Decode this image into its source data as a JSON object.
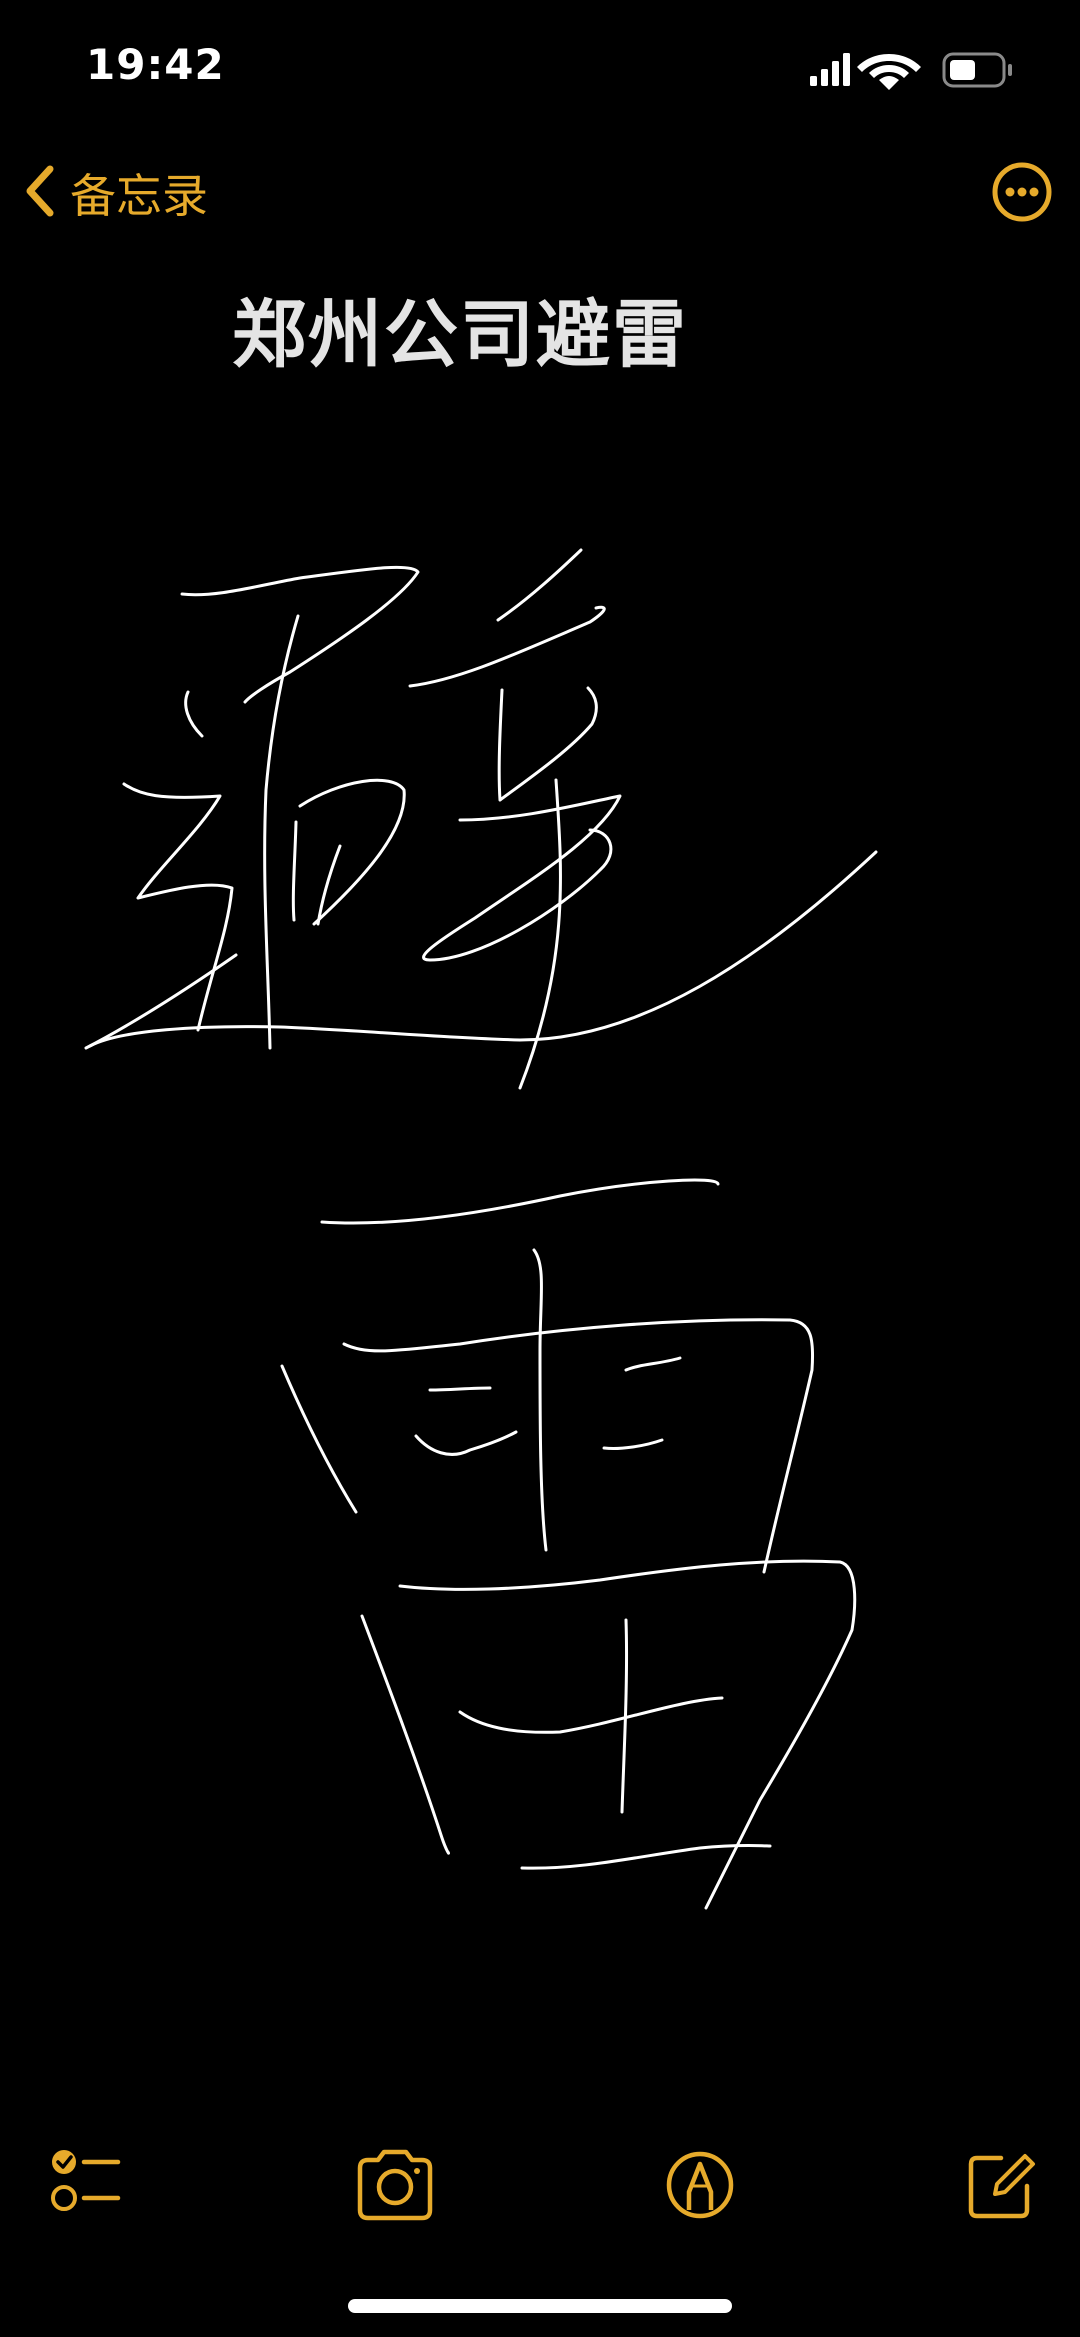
{
  "status_bar": {
    "time": "19:42",
    "icons": [
      "cellular-signal-icon",
      "wifi-icon",
      "battery-icon"
    ],
    "battery_level": 0.45
  },
  "nav": {
    "back_label": "备忘录",
    "back_icon": "chevron-left-icon",
    "more_icon": "more-ellipsis-icon"
  },
  "note": {
    "title": "郑州公司避雷",
    "drawing_description_icon": "handwriting-drawing"
  },
  "toolbar": {
    "items": [
      {
        "icon": "checklist-icon"
      },
      {
        "icon": "camera-icon"
      },
      {
        "icon": "markup-pen-icon"
      },
      {
        "icon": "compose-icon"
      }
    ]
  },
  "colors": {
    "accent": "#e6aa2b",
    "background": "#000000",
    "title_text": "#e4e4e4",
    "ink": "#ffffff"
  }
}
